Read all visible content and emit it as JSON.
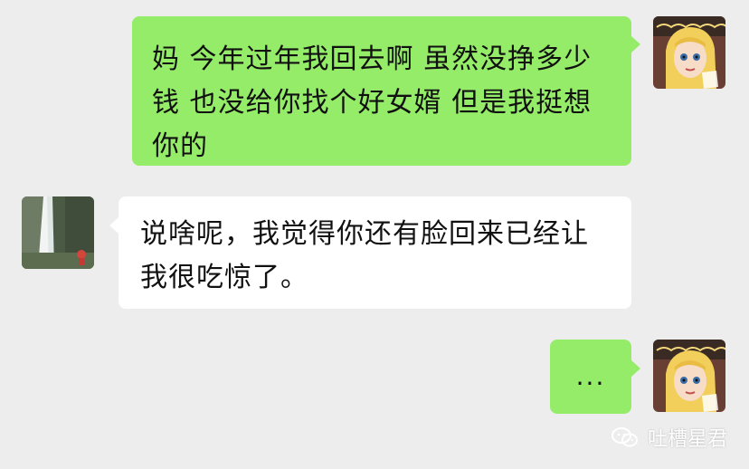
{
  "chat": {
    "messages": [
      {
        "sender": "self",
        "text": "妈 今年过年我回去啊 虽然没挣多少钱 也没给你找个好女婿 但是我挺想你的",
        "avatar_icon": "cartoon-girl-avatar"
      },
      {
        "sender": "other",
        "text": "说啥呢，我觉得你还有脸回来已经让我很吃惊了。",
        "avatar_icon": "waterfall-photo-avatar"
      },
      {
        "sender": "self",
        "text": "...",
        "avatar_icon": "cartoon-girl-avatar"
      }
    ]
  },
  "watermark": {
    "icon": "wechat-icon",
    "text": "吐槽星君"
  },
  "colors": {
    "background": "#ededed",
    "self_bubble": "#95ec69",
    "other_bubble": "#ffffff"
  }
}
